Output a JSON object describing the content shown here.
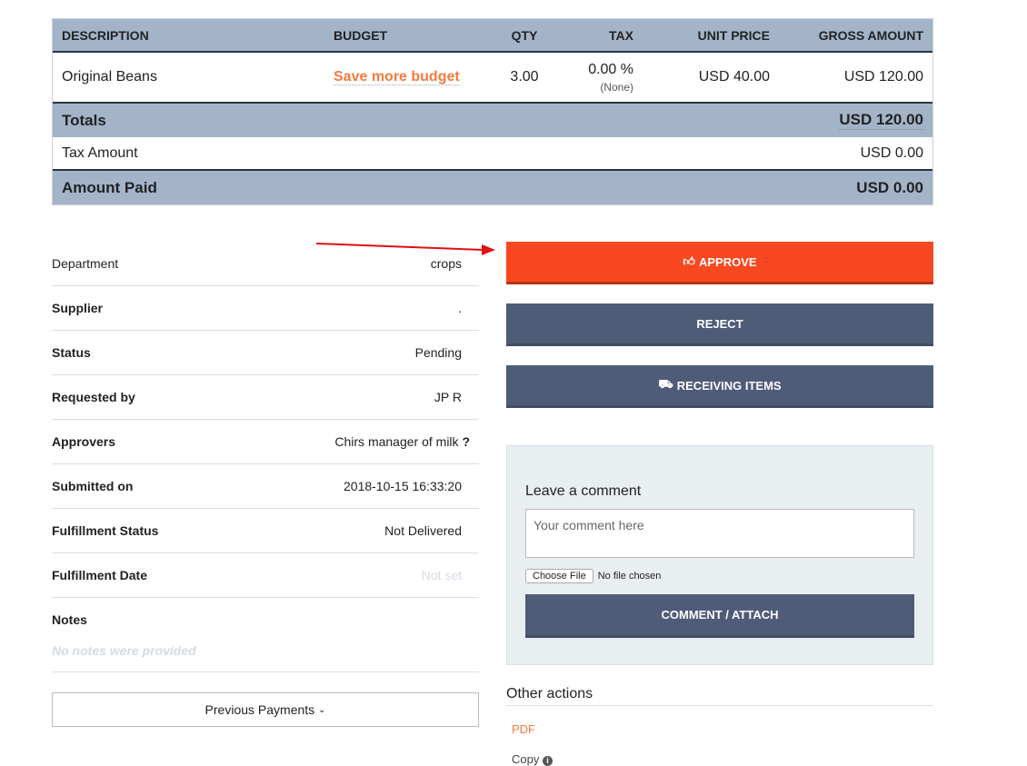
{
  "table": {
    "headers": [
      "DESCRIPTION",
      "BUDGET",
      "QTY",
      "TAX",
      "UNIT PRICE",
      "GROSS AMOUNT"
    ],
    "item": {
      "description": "Original Beans",
      "budget": "Save more budget",
      "qty": "3.00",
      "tax": "0.00 %",
      "tax_note": "(None)",
      "unit_price": "USD 40.00",
      "gross": "USD 120.00"
    },
    "totals": {
      "label": "Totals",
      "value": "USD 120.00"
    },
    "tax_amount": {
      "label": "Tax Amount",
      "value": "USD 0.00"
    },
    "amount_paid": {
      "label": "Amount Paid",
      "value": "USD 0.00"
    }
  },
  "details": [
    {
      "label": "Department",
      "value": "crops"
    },
    {
      "label": "Supplier",
      "value": "."
    },
    {
      "label": "Status",
      "value": "Pending"
    },
    {
      "label": "Requested by",
      "value": "JP R"
    },
    {
      "label": "Approvers",
      "value": "Chirs manager of milk",
      "extra": "?"
    },
    {
      "label": "Submitted on",
      "value": "2018-10-15 16:33:20"
    },
    {
      "label": "Fulfillment Status",
      "value": "Not Delivered"
    },
    {
      "label": "Fulfillment Date",
      "value": "Not set"
    }
  ],
  "notes": {
    "label": "Notes",
    "value": "No notes were provided"
  },
  "previous_payments": "Previous Payments",
  "actions": {
    "approve": "APPROVE",
    "reject": "REJECT",
    "receiving": "RECEIVING ITEMS"
  },
  "comment": {
    "title": "Leave a comment",
    "placeholder": "Your comment here",
    "choose_file": "Choose File",
    "no_file": "No file chosen",
    "submit": "COMMENT / ATTACH"
  },
  "other_actions": {
    "title": "Other actions",
    "pdf": "PDF",
    "copy": "Copy"
  },
  "colors": {
    "approve": "#f74821",
    "secondary": "#4f5c78",
    "header": "#a3b4c9",
    "link": "#f47a3e"
  }
}
